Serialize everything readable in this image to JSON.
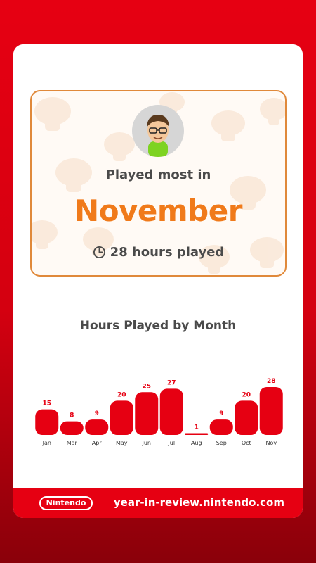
{
  "summary": {
    "played_label": "Played most in",
    "month": "November",
    "hours_text": "28 hours played"
  },
  "chart_data": {
    "type": "bar",
    "title": "Hours Played by Month",
    "categories": [
      "Jan",
      "Mar",
      "Apr",
      "May",
      "Jun",
      "Jul",
      "Aug",
      "Sep",
      "Oct",
      "Nov"
    ],
    "values": [
      15,
      8,
      9,
      20,
      25,
      27,
      1,
      9,
      20,
      28
    ],
    "ylim": [
      0,
      28
    ],
    "bar_color": "#e60012"
  },
  "footer": {
    "logo_text": "Nintendo",
    "url": "year-in-review.nintendo.com"
  },
  "colors": {
    "brand_red": "#e60012",
    "accent_orange": "#f07a1a",
    "border_orange": "#e0893a"
  },
  "icons": {
    "avatar": "mii-avatar-icon",
    "clock": "clock-icon",
    "pattern": "mushroom-icon"
  }
}
